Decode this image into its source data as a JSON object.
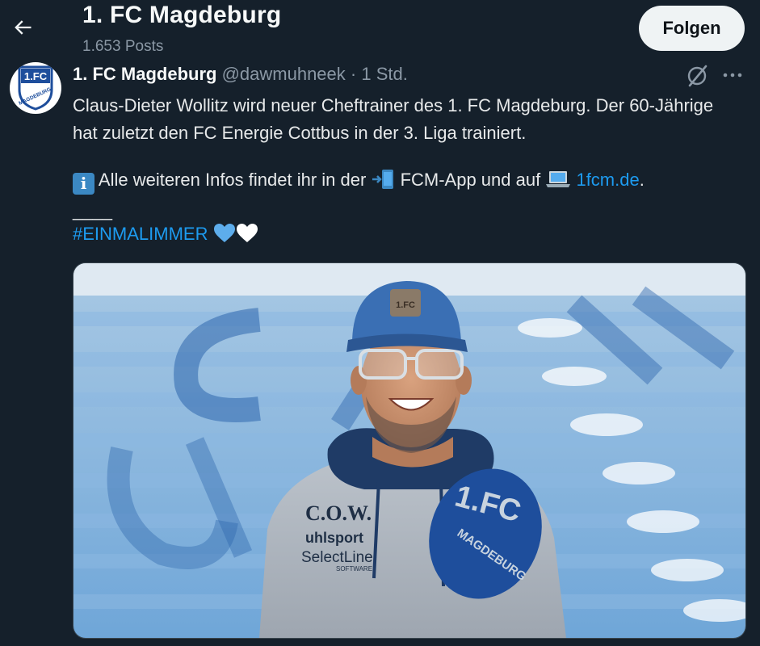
{
  "header": {
    "title": "1. FC Magdeburg",
    "posts_count": "1.653 Posts",
    "follow_label": "Folgen"
  },
  "tweet": {
    "display_name": "1. FC Magdeburg",
    "handle": "@dawmuhneek",
    "separator": "·",
    "time": "1 Std.",
    "text_line1": "Claus-Dieter Wollitz wird neuer Cheftrainer des 1. FC Magdeburg. Der 60-Jährige hat zuletzt den FC Energie Cottbus in der 3. Liga trainiert.",
    "info_text_part1": "Alle weiteren Infos findet ihr in der",
    "info_text_part2": "FCM-App und auf",
    "link_text": "1fcm.de",
    "link_suffix": ".",
    "separator_line": "____",
    "hashtag": "#EINMALIMMER",
    "avatar_text": "1.FC",
    "avatar_subtext": "MAGDEBURG"
  },
  "photo": {
    "cap_badge": "1.FC",
    "shirt_initials": "C.O.W.",
    "shirt_brand": "uhlsport",
    "shirt_sponsor": "SelectLine",
    "shirt_sponsor_sub": "SOFTWARE",
    "shirt_logo_top": "1.FC",
    "shirt_logo_bottom": "MAGDEBURG"
  },
  "colors": {
    "background": "#15202b",
    "accent": "#1d9bf0",
    "muted": "#8b98a5",
    "club_blue": "#1e4e9c"
  },
  "icons": [
    "back-arrow-icon",
    "grok-icon",
    "more-icon",
    "info-emoji-icon",
    "phone-emoji-icon",
    "laptop-emoji-icon",
    "blue-heart-icon",
    "white-heart-icon"
  ]
}
